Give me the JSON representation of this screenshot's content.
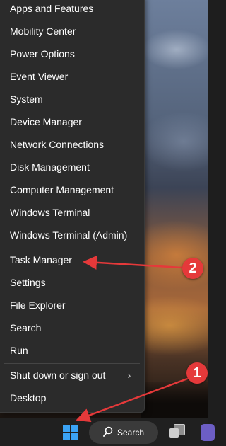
{
  "menu": {
    "items": [
      {
        "label": "Apps and Features"
      },
      {
        "label": "Mobility Center"
      },
      {
        "label": "Power Options"
      },
      {
        "label": "Event Viewer"
      },
      {
        "label": "System"
      },
      {
        "label": "Device Manager"
      },
      {
        "label": "Network Connections"
      },
      {
        "label": "Disk Management"
      },
      {
        "label": "Computer Management"
      },
      {
        "label": "Windows Terminal"
      },
      {
        "label": "Windows Terminal (Admin)"
      },
      {
        "label": "Task Manager"
      },
      {
        "label": "Settings"
      },
      {
        "label": "File Explorer"
      },
      {
        "label": "Search"
      },
      {
        "label": "Run"
      },
      {
        "label": "Shut down or sign out"
      },
      {
        "label": "Desktop"
      }
    ],
    "submenu_chevron": "chevron-right-icon"
  },
  "taskbar": {
    "start_icon": "windows-start-icon",
    "search_label": "Search",
    "search_icon": "search-icon",
    "task_view_icon": "task-view-icon",
    "app_icon": "app-icon"
  },
  "annotations": {
    "color": "#e5393a",
    "callouts": [
      {
        "number": "1",
        "points_to": "windows-start-button"
      },
      {
        "number": "2",
        "points_to": "menu-item-task-manager"
      }
    ]
  }
}
